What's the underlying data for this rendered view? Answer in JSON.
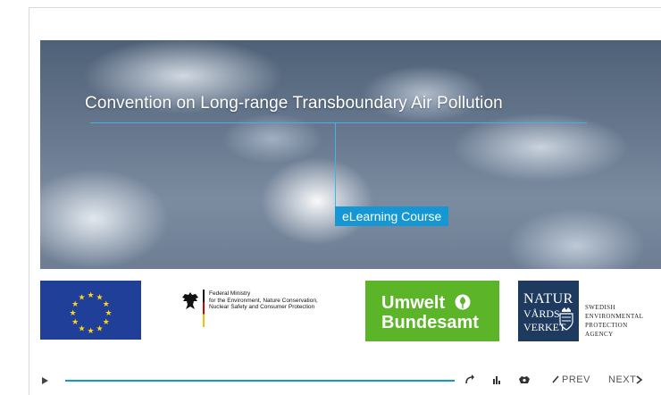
{
  "hero": {
    "title": "Convention on Long-range Transboundary Air Pollution",
    "badge": "eLearning Course"
  },
  "logos": {
    "eu": {
      "icon": "eu-flag-icon",
      "color": "#1f3f99"
    },
    "bmu": {
      "line1": "Federal Ministry",
      "line2": "for the Environment, Nature Conservation,",
      "line3": "Nuclear Safety and Consumer Protection"
    },
    "uba": {
      "line1": "Umwelt",
      "line2": "Bundesamt",
      "color": "#5cb528"
    },
    "naturvardsverket": {
      "line1": "NATUR",
      "line2": "VÅRDS",
      "line3": "VERKET",
      "side1": "SWEDISH",
      "side2": "ENVIRONMENTAL",
      "side3": "PROTECTION",
      "side4": "AGENCY",
      "color": "#1e3a5f"
    }
  },
  "controls": {
    "play_icon": "play-icon",
    "prev_label": "PREV",
    "next_label": "NEXT",
    "accent": "#1597d4"
  }
}
